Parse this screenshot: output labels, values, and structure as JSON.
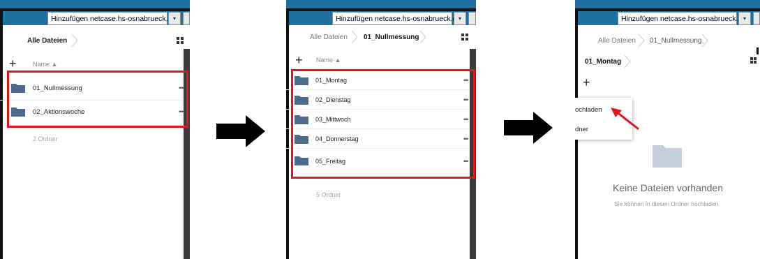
{
  "browser": {
    "address_text": "Hinzufügen netcase.hs-osnabrueck.de",
    "dropdown_glyph": "▾"
  },
  "panel1": {
    "breadcrumb": [
      "Alle Dateien"
    ],
    "column_header": "Name ▲",
    "folders": [
      "01_Nullmessung",
      "02_Aktionswoche"
    ],
    "folder_count": "2 Ordner",
    "more_glyph": "•••"
  },
  "panel2": {
    "breadcrumb": [
      "Alle Dateien",
      "01_Nullmessung"
    ],
    "column_header": "Name ▲",
    "folders": [
      "01_Montag",
      "02_Dienstag",
      "03_Mittwoch",
      "04_Donnerstag",
      "05_Freitag"
    ],
    "folder_count": "5 Ordner",
    "more_glyph": "•••"
  },
  "panel3": {
    "breadcrumb": [
      "Alle Dateien",
      "01_Nullmessung",
      "01_Montag"
    ],
    "plus": "+",
    "menu": [
      "ochladen",
      "dner"
    ],
    "empty_title": "Keine Dateien vorhanden",
    "empty_subtitle": "Sie können in diesen Ordner hochladen"
  },
  "colors": {
    "topbar": "#1f6fa0",
    "highlight": "#e3151a",
    "folder": "#4d6a8d",
    "empty_folder": "#c3cfdb"
  },
  "icons": [
    "grid-view-icon",
    "add-icon",
    "folder-icon",
    "more-icon",
    "chevron-right-icon",
    "arrow-right-icon",
    "pointer-arrow-icon"
  ]
}
